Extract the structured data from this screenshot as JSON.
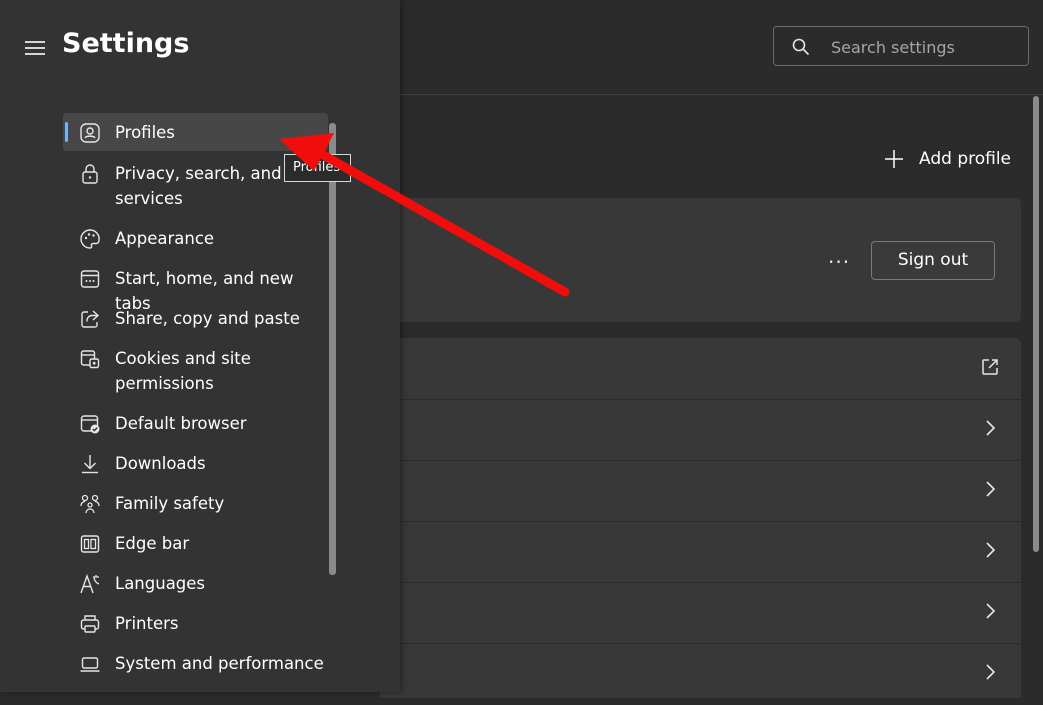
{
  "sidebar": {
    "title": "Settings",
    "items": [
      {
        "label": "Profiles",
        "icon": "profile-icon"
      },
      {
        "label": "Privacy, search, and services",
        "icon": "lock-icon"
      },
      {
        "label": "Appearance",
        "icon": "palette-icon"
      },
      {
        "label": "Start, home, and new tabs",
        "icon": "start-home-icon"
      },
      {
        "label": "Share, copy and paste",
        "icon": "share-icon"
      },
      {
        "label": "Cookies and site permissions",
        "icon": "cookies-icon"
      },
      {
        "label": "Default browser",
        "icon": "default-browser-icon"
      },
      {
        "label": "Downloads",
        "icon": "download-icon"
      },
      {
        "label": "Family safety",
        "icon": "family-icon"
      },
      {
        "label": "Edge bar",
        "icon": "edge-bar-icon"
      },
      {
        "label": "Languages",
        "icon": "languages-icon"
      },
      {
        "label": "Printers",
        "icon": "printer-icon"
      },
      {
        "label": "System and performance",
        "icon": "system-icon"
      }
    ],
    "active_index": 0
  },
  "search": {
    "placeholder": "Search settings",
    "icon": "search-icon"
  },
  "main": {
    "add_profile_label": "Add profile",
    "sign_out_label": "Sign out",
    "more_label": "···",
    "rows": [
      {
        "icon": "external-link-icon"
      },
      {
        "icon": "chevron-right-icon"
      },
      {
        "icon": "chevron-right-icon"
      },
      {
        "icon": "chevron-right-icon"
      },
      {
        "icon": "chevron-right-icon"
      },
      {
        "icon": "chevron-right-icon"
      }
    ]
  },
  "tooltip": {
    "text": "Profiles"
  },
  "colors": {
    "accent": "#74b6f5",
    "arrow": "#f20d0d",
    "sidebar_bg": "#333333",
    "card_bg": "#383838"
  }
}
